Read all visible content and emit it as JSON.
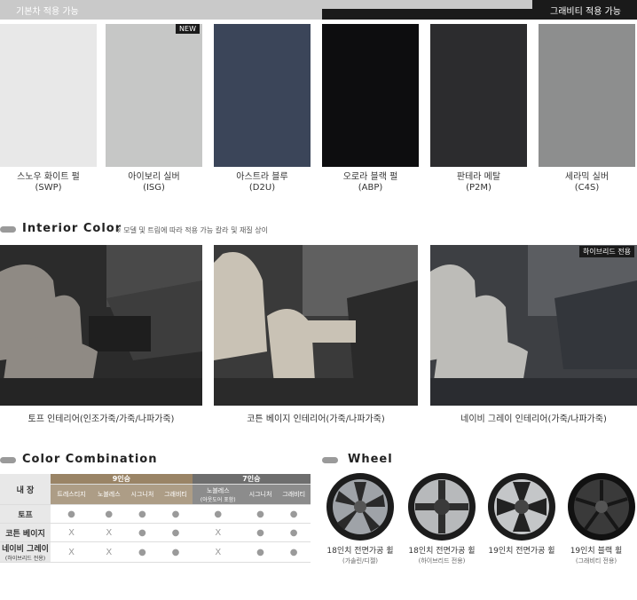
{
  "top_bar": {
    "basic_label": "기본차 적용 가능",
    "graphite_label": "그래비티 적용 가능"
  },
  "exterior_colors": [
    {
      "name": "스노우 화이트 펄",
      "code": "(SWP)",
      "color": "#e8e8e8"
    },
    {
      "name": "아이보리 실버",
      "code": "(ISG)",
      "color": "#c6c7c6",
      "badge": "NEW"
    },
    {
      "name": "아스트라 블루",
      "code": "(D2U)",
      "color": "#3b4559"
    },
    {
      "name": "오로라 블랙 펄",
      "code": "(ABP)",
      "color": "#0d0d0f"
    },
    {
      "name": "판테라 메탈",
      "code": "(P2M)",
      "color": "#2c2c2e"
    },
    {
      "name": "세라믹 실버",
      "code": "(C4S)",
      "color": "#8d8e8e"
    }
  ],
  "interior": {
    "title": "Interior Color",
    "note": "※ 모델 및 트림에 따라 적용 가능 칼라 및 재질 상이",
    "items": [
      {
        "label": "토프 인테리어(인조가죽/가죽/나파가죽)",
        "seat": "#8f8a84",
        "dash": "#3a3a3a"
      },
      {
        "label": "코튼 베이지 인테리어(가죽/나파가죽)",
        "seat": "#c9c2b5",
        "dash": "#3a3a3a"
      },
      {
        "label": "네이비 그레이 인테리어(가죽/나파가죽)",
        "seat": "#bdbcb8",
        "dash": "#2e3136",
        "badge": "하이브리드 전용"
      }
    ]
  },
  "combination": {
    "title": "Color Combination",
    "header_label": "내 장",
    "group9": "9인승",
    "group7": "7인승",
    "trims9": [
      "트레스티지",
      "노블레스",
      "시그니처",
      "그래비티"
    ],
    "trims7": [
      {
        "name": "노블레스",
        "sub": "(아웃도어 포함)"
      },
      {
        "name": "시그니처"
      },
      {
        "name": "그래비티"
      }
    ],
    "rows": [
      {
        "name": "토프",
        "sub": "",
        "cells": [
          "●",
          "●",
          "●",
          "●",
          "●",
          "●",
          "●"
        ]
      },
      {
        "name": "코튼 베이지",
        "sub": "",
        "cells": [
          "X",
          "X",
          "●",
          "●",
          "X",
          "●",
          "●"
        ]
      },
      {
        "name": "네이비 그레이",
        "sub": "(하이브리드 전용)",
        "cells": [
          "X",
          "X",
          "●",
          "●",
          "X",
          "●",
          "●"
        ]
      }
    ]
  },
  "wheels": {
    "title": "Wheel",
    "items": [
      {
        "name": "18인치 전면가공 휠",
        "sub": "(가솔린/디젤)"
      },
      {
        "name": "18인치 전면가공 휠",
        "sub": "(하이브리드 전용)"
      },
      {
        "name": "19인치 전면가공 휠",
        "sub": ""
      },
      {
        "name": "19인치 블랙 휠",
        "sub": "(그래비티 전용)"
      }
    ]
  }
}
